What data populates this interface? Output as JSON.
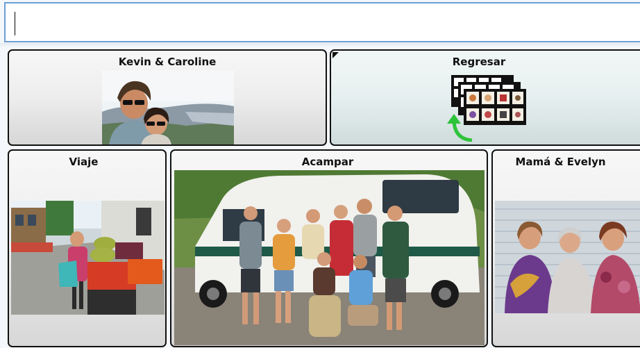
{
  "message_bar": {
    "value": ""
  },
  "buttons": {
    "kevin": {
      "label": "Kevin & Caroline"
    },
    "regresar": {
      "label": "Regresar"
    },
    "viaje": {
      "label": "Viaje"
    },
    "acampar": {
      "label": "Acampar"
    },
    "mama": {
      "label": "Mamá & Evelyn"
    }
  },
  "icons": {
    "regresar": "board-stack-back-icon"
  },
  "colors": {
    "message_border": "#6b9fd3",
    "back_arrow": "#2ec43a"
  }
}
